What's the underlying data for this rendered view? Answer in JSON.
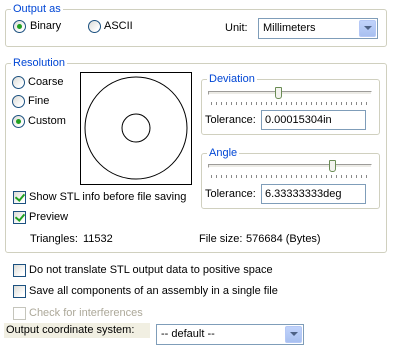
{
  "output_as": {
    "title": "Output as",
    "binary_label": "Binary",
    "ascii_label": "ASCII",
    "selected": "Binary",
    "unit_label": "Unit:",
    "unit_value": "Millimeters"
  },
  "resolution": {
    "title": "Resolution",
    "coarse_label": "Coarse",
    "fine_label": "Fine",
    "custom_label": "Custom",
    "selected": "Custom",
    "show_stl_info_label": "Show STL info before file saving",
    "show_stl_info_checked": true,
    "preview_label": "Preview",
    "preview_checked": true,
    "triangles_label": "Triangles:",
    "triangles_value": "11532",
    "file_size_label": "File size:",
    "file_size_value": "576684 (Bytes)",
    "deviation": {
      "title": "Deviation",
      "slider_level": 0.48,
      "tolerance_label": "Tolerance:",
      "tolerance_value": "0.00015304in"
    },
    "angle": {
      "title": "Angle",
      "slider_level": 0.85,
      "tolerance_label": "Tolerance:",
      "tolerance_value": "6.33333333deg"
    }
  },
  "options": {
    "no_translate_label": "Do not translate STL output data to positive space",
    "no_translate_checked": false,
    "save_all_label": "Save all components of an assembly in a single file",
    "save_all_checked": false,
    "check_interferences_label": "Check for interferences",
    "check_interferences_enabled": false
  },
  "coordinate_system": {
    "label": "Output coordinate system:",
    "value": "-- default --"
  },
  "colors": {
    "group_title": "#0046d5",
    "check_mark": "#21a121",
    "disabled_text": "#aca899"
  }
}
